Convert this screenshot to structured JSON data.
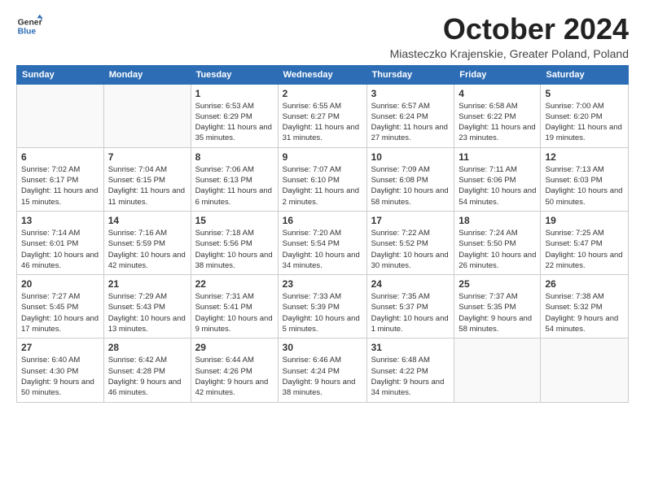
{
  "header": {
    "logo": {
      "general": "General",
      "blue": "Blue"
    },
    "title": "October 2024",
    "subtitle": "Miasteczko Krajenskie, Greater Poland, Poland"
  },
  "days_of_week": [
    "Sunday",
    "Monday",
    "Tuesday",
    "Wednesday",
    "Thursday",
    "Friday",
    "Saturday"
  ],
  "weeks": [
    [
      {
        "day": "",
        "info": ""
      },
      {
        "day": "",
        "info": ""
      },
      {
        "day": "1",
        "info": "Sunrise: 6:53 AM\nSunset: 6:29 PM\nDaylight: 11 hours and 35 minutes."
      },
      {
        "day": "2",
        "info": "Sunrise: 6:55 AM\nSunset: 6:27 PM\nDaylight: 11 hours and 31 minutes."
      },
      {
        "day": "3",
        "info": "Sunrise: 6:57 AM\nSunset: 6:24 PM\nDaylight: 11 hours and 27 minutes."
      },
      {
        "day": "4",
        "info": "Sunrise: 6:58 AM\nSunset: 6:22 PM\nDaylight: 11 hours and 23 minutes."
      },
      {
        "day": "5",
        "info": "Sunrise: 7:00 AM\nSunset: 6:20 PM\nDaylight: 11 hours and 19 minutes."
      }
    ],
    [
      {
        "day": "6",
        "info": "Sunrise: 7:02 AM\nSunset: 6:17 PM\nDaylight: 11 hours and 15 minutes."
      },
      {
        "day": "7",
        "info": "Sunrise: 7:04 AM\nSunset: 6:15 PM\nDaylight: 11 hours and 11 minutes."
      },
      {
        "day": "8",
        "info": "Sunrise: 7:06 AM\nSunset: 6:13 PM\nDaylight: 11 hours and 6 minutes."
      },
      {
        "day": "9",
        "info": "Sunrise: 7:07 AM\nSunset: 6:10 PM\nDaylight: 11 hours and 2 minutes."
      },
      {
        "day": "10",
        "info": "Sunrise: 7:09 AM\nSunset: 6:08 PM\nDaylight: 10 hours and 58 minutes."
      },
      {
        "day": "11",
        "info": "Sunrise: 7:11 AM\nSunset: 6:06 PM\nDaylight: 10 hours and 54 minutes."
      },
      {
        "day": "12",
        "info": "Sunrise: 7:13 AM\nSunset: 6:03 PM\nDaylight: 10 hours and 50 minutes."
      }
    ],
    [
      {
        "day": "13",
        "info": "Sunrise: 7:14 AM\nSunset: 6:01 PM\nDaylight: 10 hours and 46 minutes."
      },
      {
        "day": "14",
        "info": "Sunrise: 7:16 AM\nSunset: 5:59 PM\nDaylight: 10 hours and 42 minutes."
      },
      {
        "day": "15",
        "info": "Sunrise: 7:18 AM\nSunset: 5:56 PM\nDaylight: 10 hours and 38 minutes."
      },
      {
        "day": "16",
        "info": "Sunrise: 7:20 AM\nSunset: 5:54 PM\nDaylight: 10 hours and 34 minutes."
      },
      {
        "day": "17",
        "info": "Sunrise: 7:22 AM\nSunset: 5:52 PM\nDaylight: 10 hours and 30 minutes."
      },
      {
        "day": "18",
        "info": "Sunrise: 7:24 AM\nSunset: 5:50 PM\nDaylight: 10 hours and 26 minutes."
      },
      {
        "day": "19",
        "info": "Sunrise: 7:25 AM\nSunset: 5:47 PM\nDaylight: 10 hours and 22 minutes."
      }
    ],
    [
      {
        "day": "20",
        "info": "Sunrise: 7:27 AM\nSunset: 5:45 PM\nDaylight: 10 hours and 17 minutes."
      },
      {
        "day": "21",
        "info": "Sunrise: 7:29 AM\nSunset: 5:43 PM\nDaylight: 10 hours and 13 minutes."
      },
      {
        "day": "22",
        "info": "Sunrise: 7:31 AM\nSunset: 5:41 PM\nDaylight: 10 hours and 9 minutes."
      },
      {
        "day": "23",
        "info": "Sunrise: 7:33 AM\nSunset: 5:39 PM\nDaylight: 10 hours and 5 minutes."
      },
      {
        "day": "24",
        "info": "Sunrise: 7:35 AM\nSunset: 5:37 PM\nDaylight: 10 hours and 1 minute."
      },
      {
        "day": "25",
        "info": "Sunrise: 7:37 AM\nSunset: 5:35 PM\nDaylight: 9 hours and 58 minutes."
      },
      {
        "day": "26",
        "info": "Sunrise: 7:38 AM\nSunset: 5:32 PM\nDaylight: 9 hours and 54 minutes."
      }
    ],
    [
      {
        "day": "27",
        "info": "Sunrise: 6:40 AM\nSunset: 4:30 PM\nDaylight: 9 hours and 50 minutes."
      },
      {
        "day": "28",
        "info": "Sunrise: 6:42 AM\nSunset: 4:28 PM\nDaylight: 9 hours and 46 minutes."
      },
      {
        "day": "29",
        "info": "Sunrise: 6:44 AM\nSunset: 4:26 PM\nDaylight: 9 hours and 42 minutes."
      },
      {
        "day": "30",
        "info": "Sunrise: 6:46 AM\nSunset: 4:24 PM\nDaylight: 9 hours and 38 minutes."
      },
      {
        "day": "31",
        "info": "Sunrise: 6:48 AM\nSunset: 4:22 PM\nDaylight: 9 hours and 34 minutes."
      },
      {
        "day": "",
        "info": ""
      },
      {
        "day": "",
        "info": ""
      }
    ]
  ]
}
